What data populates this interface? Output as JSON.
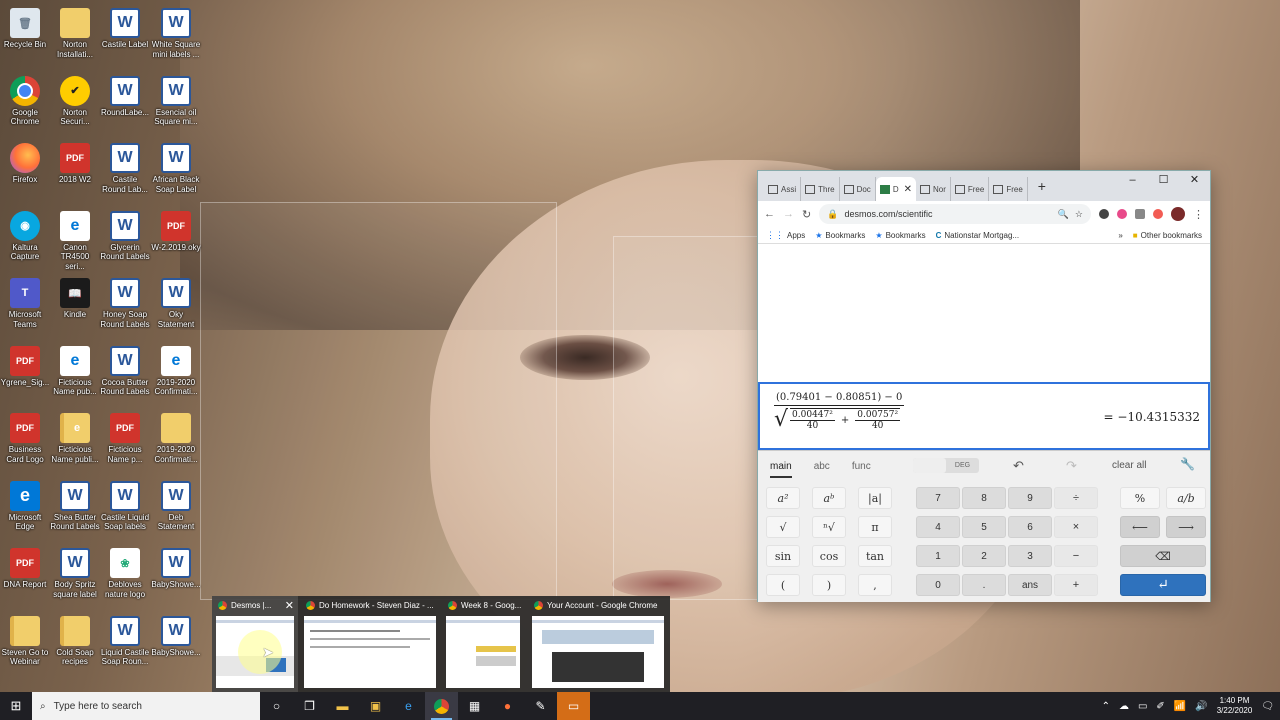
{
  "desktop": {
    "icons": [
      {
        "label": "Recycle Bin",
        "type": "bin",
        "glyph": "🗑"
      },
      {
        "label": "Norton\nInstallati...",
        "type": "folder",
        "glyph": ""
      },
      {
        "label": "Castile Label",
        "type": "word",
        "glyph": "W"
      },
      {
        "label": "White Square\nmini labels ...",
        "type": "word",
        "glyph": "W"
      },
      {
        "label": "Google\nChrome",
        "type": "chrome",
        "glyph": ""
      },
      {
        "label": "Norton\nSecuri...",
        "type": "norton",
        "glyph": "✔"
      },
      {
        "label": "RoundLabe...",
        "type": "word",
        "glyph": "W"
      },
      {
        "label": "Esencial oil\nSquare mi...",
        "type": "word",
        "glyph": "W"
      },
      {
        "label": "Firefox",
        "type": "firefox",
        "glyph": ""
      },
      {
        "label": "2018 W2",
        "type": "pdf",
        "glyph": "PDF"
      },
      {
        "label": "Castile\nRound Lab...",
        "type": "word",
        "glyph": "W"
      },
      {
        "label": "African Black\nSoap Label",
        "type": "word",
        "glyph": "W"
      },
      {
        "label": "Kaltura\nCapture",
        "type": "kaltura",
        "glyph": "◉"
      },
      {
        "label": "Canon\nTR4500 seri...",
        "type": "canon",
        "glyph": "e"
      },
      {
        "label": "Glycerin\nRound Labels",
        "type": "word",
        "glyph": "W"
      },
      {
        "label": "W-2.2019.oky",
        "type": "pdf",
        "glyph": "PDF"
      },
      {
        "label": "Microsoft\nTeams",
        "type": "teams",
        "glyph": "T"
      },
      {
        "label": "Kindle",
        "type": "kindle",
        "glyph": "📖"
      },
      {
        "label": "Honey Soap\nRound Labels",
        "type": "word",
        "glyph": "W"
      },
      {
        "label": "Oky\nStatement",
        "type": "word",
        "glyph": "W"
      },
      {
        "label": "Ygrene_Sig...",
        "type": "pdf",
        "glyph": "PDF"
      },
      {
        "label": "Ficticious\nName pub...",
        "type": "canon",
        "glyph": "e"
      },
      {
        "label": "Cocoa Butter\nRound Labels",
        "type": "word",
        "glyph": "W"
      },
      {
        "label": "2019-2020\nConfirmati...",
        "type": "canon",
        "glyph": "e"
      },
      {
        "label": "Business\nCard Logo",
        "type": "pdf",
        "glyph": "PDF"
      },
      {
        "label": "Ficticious\nName publi...",
        "type": "folderdoc",
        "glyph": "e"
      },
      {
        "label": "Ficticious\nName p...",
        "type": "pdf",
        "glyph": "PDF"
      },
      {
        "label": "2019-2020\nConfirmati...",
        "type": "folder",
        "glyph": ""
      },
      {
        "label": "Microsoft\nEdge",
        "type": "edge",
        "glyph": "e"
      },
      {
        "label": "Shea Butter\nRound Labels",
        "type": "word",
        "glyph": "W"
      },
      {
        "label": "Castile Liquid\nSoap labels",
        "type": "word",
        "glyph": "W"
      },
      {
        "label": "Deb\nStatement",
        "type": "word",
        "glyph": "W"
      },
      {
        "label": "DNA Report",
        "type": "pdf",
        "glyph": "PDF"
      },
      {
        "label": "Body Spritz\nsquare label",
        "type": "word",
        "glyph": "W"
      },
      {
        "label": "Debloves\nnature logo",
        "type": "debloves",
        "glyph": "❀"
      },
      {
        "label": "BabyShowe...",
        "type": "word",
        "glyph": "W"
      },
      {
        "label": "Steven Go to\nWebinar",
        "type": "folderdoc",
        "glyph": ""
      },
      {
        "label": "Cold Soap\nrecipes",
        "type": "folderdoc",
        "glyph": ""
      },
      {
        "label": "Liquid Castile\nSoap Roun...",
        "type": "word",
        "glyph": "W"
      },
      {
        "label": "BabyShowe...",
        "type": "word",
        "glyph": "W"
      }
    ]
  },
  "browser": {
    "tabs": [
      {
        "label": "Assi"
      },
      {
        "label": "Thre"
      },
      {
        "label": "Doc"
      },
      {
        "label": "D",
        "active": true
      },
      {
        "label": "Nor"
      },
      {
        "label": "Free"
      },
      {
        "label": "Free"
      }
    ],
    "new_tab": "+",
    "controls": {
      "minimize": "–",
      "maximize": "☐",
      "close": "✕"
    },
    "url": "desmos.com/scientific",
    "bookmarks": [
      {
        "label": "Apps",
        "icon": "apps-icon"
      },
      {
        "label": "Bookmarks",
        "icon": "star-icon"
      },
      {
        "label": "Bookmarks",
        "icon": "star-icon"
      },
      {
        "label": "Nationstar Mortgag...",
        "icon": "site-icon"
      }
    ],
    "more_bookmarks": "»",
    "other_bookmarks": "Other bookmarks"
  },
  "calculator": {
    "expression": {
      "numerator": "(0.79401 − 0.80851) − 0",
      "term1_num": "0.00447²",
      "term1_den": "40",
      "plus": "+",
      "term2_num": "0.00757²",
      "term2_den": "40"
    },
    "result": "= −10.4315332",
    "tabs": [
      "main",
      "abc",
      "func"
    ],
    "active_tab": "main",
    "angle_modes": [
      "",
      "DEG"
    ],
    "clear_all": "clear all",
    "keys": {
      "a2": "a²",
      "ab": "aᵇ",
      "abs": "|a|",
      "sqrt": "√",
      "nroot": "ⁿ√",
      "pi": "π",
      "sin": "sin",
      "cos": "cos",
      "tan": "tan",
      "lparen": "(",
      "rparen": ")",
      "comma": ",",
      "d7": "7",
      "d8": "8",
      "d9": "9",
      "div": "÷",
      "d4": "4",
      "d5": "5",
      "d6": "6",
      "mul": "×",
      "d1": "1",
      "d2": "2",
      "d3": "3",
      "minus": "−",
      "d0": "0",
      "dot": ".",
      "ans": "ans",
      "plus": "+",
      "percent": "%",
      "frac": "a/b",
      "left": "⟵",
      "right": "⟶",
      "backspace": "⌫",
      "enter": "↵"
    }
  },
  "taskbar_previews": [
    {
      "title": "Desmos |...",
      "close": "✕"
    },
    {
      "title": "Do Homework - Steven Diaz - ..."
    },
    {
      "title": "Week 8 - Goog..."
    },
    {
      "title": "Your Account - Google Chrome"
    }
  ],
  "taskbar": {
    "search_placeholder": "Type here to search",
    "time": "1:40 PM",
    "date": "3/22/2020"
  }
}
